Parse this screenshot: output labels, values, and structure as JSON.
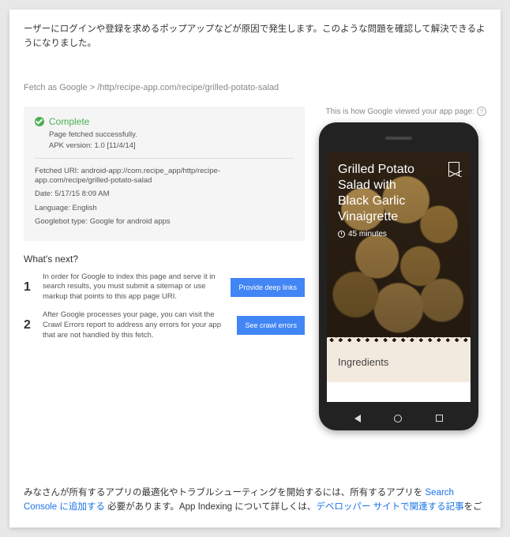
{
  "intro": "ーザーにログインや登録を求めるポップアップなどが原因で発生します。このような問題を確認して解決できるようになりました。",
  "breadcrumb": {
    "root": "Fetch as Google",
    "sep": " > ",
    "path": "/http/recipe-app.com/recipe/grilled-potato-salad"
  },
  "preview_label": "This is how Google viewed your app page:",
  "help_symbol": "?",
  "status": {
    "title": "Complete",
    "sub1": "Page fetched successfully.",
    "sub2": "APK version: 1.0 [11/4/14]",
    "fetched_uri": "Fetched URI: android-app://com.recipe_app/http/recipe-app.com/recipe/grilled-potato-salad",
    "date": "Date: 5/17/15 8:09 AM",
    "language": "Language: English",
    "bot_type": "Googlebot type: Google for android apps"
  },
  "whats_next": {
    "title": "What's next?",
    "steps": [
      {
        "num": "1",
        "text": "In order for Google to index this page and serve it in search results, you must submit a sitemap or use markup that points to this app page URI.",
        "btn": "Provide deep links"
      },
      {
        "num": "2",
        "text": "After Google processes your page, you can visit the Crawl Errors report to address any errors for your app that are not handled by this fetch.",
        "btn": "See crawl errors"
      }
    ]
  },
  "phone": {
    "recipe_title": "Grilled Potato Salad with Black Garlic Vinaigrette",
    "time": "45 minutes",
    "ingredients_label": "Ingredients"
  },
  "outro": {
    "pre": "みなさんが所有するアプリの最適化やトラブルシューティングを開始するには、所有するアプリを ",
    "link1": "Search Console に追加する",
    "mid": " 必要があります。App Indexing について詳しくは、",
    "link2": "デベロッパー サイトで関連する記事",
    "post": "をご"
  }
}
